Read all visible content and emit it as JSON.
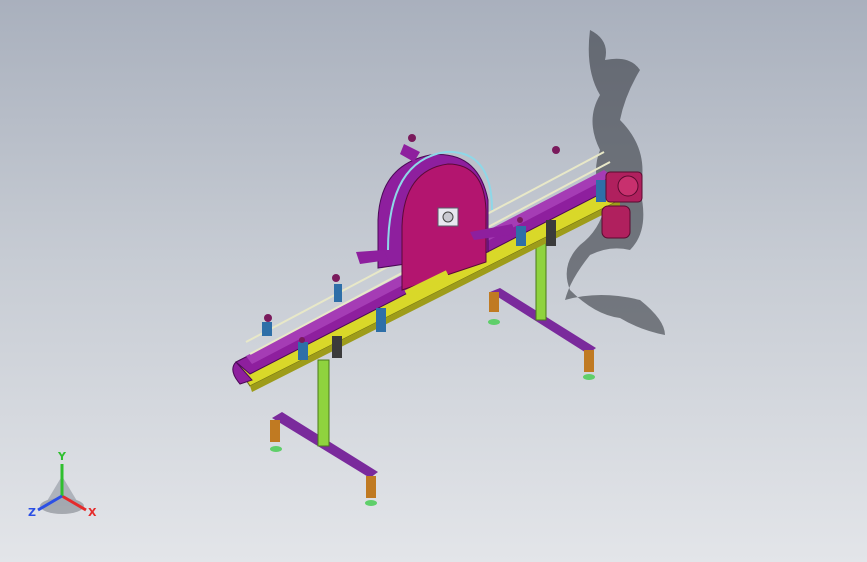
{
  "viewport": {
    "background_top": "#a9b0bd",
    "background_bottom": "#e3e5e9"
  },
  "model": {
    "colors": {
      "chain_guide": "#8e1f9e",
      "frame_beam": "#d9d829",
      "star_wheel_housing": "#b3156f",
      "support_legs": "#8fd33e",
      "feet_bars": "#7a2a9c",
      "brackets": "#2e6fa8",
      "motor": "#b0205e",
      "feet_pads": "#c07a22",
      "shadow": "#2a2e35"
    }
  },
  "triad": {
    "axes": [
      {
        "name": "x",
        "label": "X",
        "color": "#e52b2b"
      },
      {
        "name": "y",
        "label": "Y",
        "color": "#2fbf2f"
      },
      {
        "name": "z",
        "label": "Z",
        "color": "#2b4fe5"
      }
    ]
  }
}
